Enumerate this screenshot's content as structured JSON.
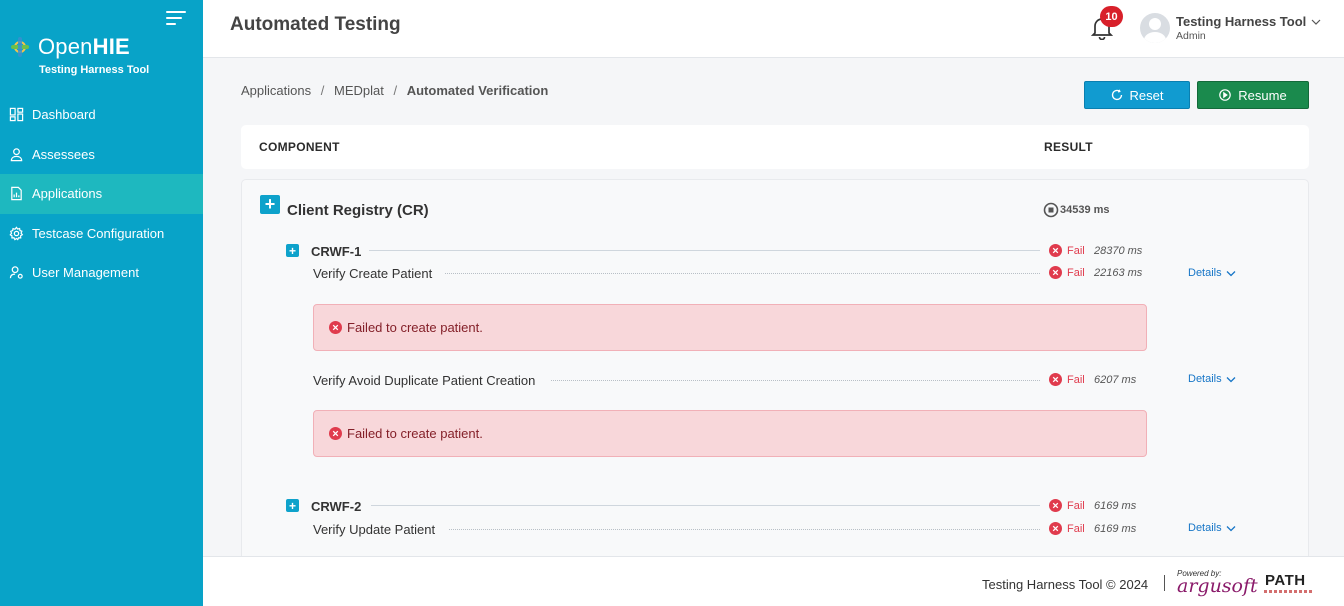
{
  "sidebar": {
    "brand": {
      "name_light": "Open",
      "name_bold": "HIE",
      "subtitle": "Testing Harness Tool"
    },
    "items": [
      {
        "label": "Dashboard",
        "icon": "dashboard-icon",
        "active": false
      },
      {
        "label": "Assessees",
        "icon": "user-icon",
        "active": false
      },
      {
        "label": "Applications",
        "icon": "document-icon",
        "active": true
      },
      {
        "label": "Testcase Configuration",
        "icon": "gear-icon",
        "active": false
      },
      {
        "label": "User Management",
        "icon": "user-cog-icon",
        "active": false
      }
    ]
  },
  "header": {
    "title": "Automated Testing",
    "notification_count": "10",
    "user": {
      "name": "Testing Harness Tool",
      "role": "Admin"
    }
  },
  "breadcrumb": {
    "items": [
      "Applications",
      "MEDplat"
    ],
    "current": "Automated Verification",
    "separator": "/"
  },
  "actions": {
    "reset_label": "Reset",
    "resume_label": "Resume"
  },
  "table": {
    "col_component": "COMPONENT",
    "col_result": "RESULT"
  },
  "component": {
    "title": "Client Registry (CR)",
    "duration": "34539 ms",
    "workflows": [
      {
        "name": "CRWF-1",
        "status": "Fail",
        "duration": "28370 ms",
        "testcases": [
          {
            "name": "Verify Create Patient",
            "status": "Fail",
            "duration": "22163 ms",
            "details_label": "Details",
            "message": "Failed to create patient."
          },
          {
            "name": "Verify Avoid Duplicate Patient Creation",
            "status": "Fail",
            "duration": "6207 ms",
            "details_label": "Details",
            "message": "Failed to create patient."
          }
        ]
      },
      {
        "name": "CRWF-2",
        "status": "Fail",
        "duration": "6169 ms",
        "testcases": [
          {
            "name": "Verify Update Patient",
            "status": "Fail",
            "duration": "6169 ms",
            "details_label": "Details"
          }
        ]
      }
    ]
  },
  "footer": {
    "copyright": "Testing Harness Tool © 2024",
    "powered_by": "Powered by:",
    "vendor": "argusoft",
    "partner": "PATH"
  },
  "colors": {
    "sidebar_bg": "#08a3c8",
    "sidebar_active": "#1eb8bf",
    "fail": "#e03b4d",
    "reset_button": "#119bd0",
    "resume_button": "#1a8a4d",
    "alert_bg": "#f8d7da"
  }
}
